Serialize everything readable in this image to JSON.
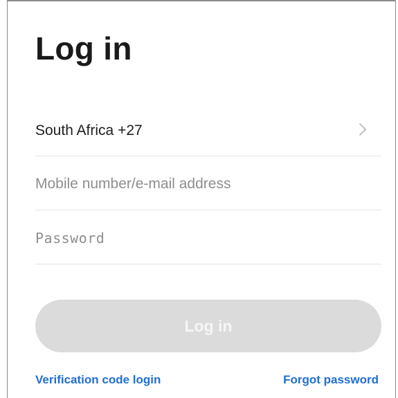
{
  "page": {
    "title": "Log in"
  },
  "region": {
    "label": "South Africa +27",
    "icon": "chevron-right-icon"
  },
  "account_field": {
    "value": "",
    "placeholder": "Mobile number/e-mail address"
  },
  "password_field": {
    "value": "",
    "placeholder": "Password"
  },
  "login_button": {
    "label": "Log in",
    "state": "disabled"
  },
  "links": {
    "verification": "Verification code login",
    "forgot": "Forgot password"
  },
  "colors": {
    "link": "#1f6fd1",
    "button_disabled_bg": "#dbdbdb",
    "button_disabled_text": "#f6f6f6",
    "divider": "#e3e3e3",
    "placeholder": "#8e8e8e"
  }
}
